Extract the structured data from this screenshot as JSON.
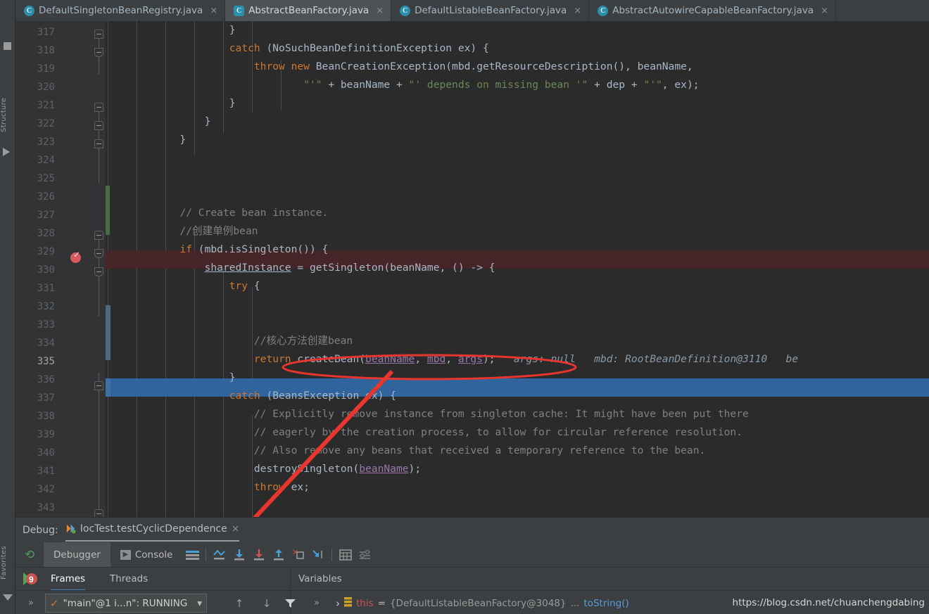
{
  "window": {
    "background": "#2b2b2b",
    "accent": "#4a88c7"
  },
  "left_strip": {
    "labels": [
      "Structure",
      "Favorites"
    ],
    "icons": [
      "tool-window-square-icon",
      "run-arrow-icon",
      "filter-icon"
    ]
  },
  "tabs": [
    {
      "label": "DefaultSingletonBeanRegistry.java",
      "icon": "java-class-icon",
      "active": false,
      "close": "×"
    },
    {
      "label": "AbstractBeanFactory.java",
      "icon": "java-class-icon",
      "active": true,
      "close": "×"
    },
    {
      "label": "DefaultListableBeanFactory.java",
      "icon": "java-class-icon",
      "active": false,
      "close": "×"
    },
    {
      "label": "AbstractAutowireCapableBeanFactory.java",
      "icon": "java-class-icon",
      "active": false,
      "close": "×"
    }
  ],
  "editor": {
    "first_line": 317,
    "current_line": 335,
    "breakpoint_line": 329,
    "line_numbers": [
      317,
      318,
      319,
      320,
      321,
      322,
      323,
      324,
      325,
      326,
      327,
      328,
      329,
      330,
      331,
      332,
      333,
      334,
      335,
      336,
      337,
      338,
      339,
      340,
      341,
      342,
      343
    ],
    "inline_debug_values": [
      "args: null",
      "mbd: RootBeanDefinition@3110",
      "be"
    ],
    "code_lines": [
      {
        "n": 317,
        "text": "                    }"
      },
      {
        "n": 318,
        "text": "                    catch (NoSuchBeanDefinitionException ex) {"
      },
      {
        "n": 319,
        "text": "                        throw new BeanCreationException(mbd.getResourceDescription(), beanName,"
      },
      {
        "n": 320,
        "text": "                                \"'\" + beanName + \"' depends on missing bean '\" + dep + \"'\", ex);"
      },
      {
        "n": 321,
        "text": "                    }"
      },
      {
        "n": 322,
        "text": "                }"
      },
      {
        "n": 323,
        "text": "            }"
      },
      {
        "n": 324,
        "text": ""
      },
      {
        "n": 325,
        "text": ""
      },
      {
        "n": 326,
        "text": ""
      },
      {
        "n": 327,
        "text": "            // Create bean instance."
      },
      {
        "n": 328,
        "text": "            //创建单例bean"
      },
      {
        "n": 329,
        "text": "            if (mbd.isSingleton()) {"
      },
      {
        "n": 330,
        "text": "                sharedInstance = getSingleton(beanName, () -> {"
      },
      {
        "n": 331,
        "text": "                    try {"
      },
      {
        "n": 332,
        "text": ""
      },
      {
        "n": 333,
        "text": ""
      },
      {
        "n": 334,
        "text": "                        //核心方法创建bean"
      },
      {
        "n": 335,
        "text": "                        return createBean(beanName, mbd, args);"
      },
      {
        "n": 336,
        "text": "                    }"
      },
      {
        "n": 337,
        "text": "                    catch (BeansException ex) {"
      },
      {
        "n": 338,
        "text": "                        // Explicitly remove instance from singleton cache: It might have been put there"
      },
      {
        "n": 339,
        "text": "                        // eagerly by the creation process, to allow for circular reference resolution."
      },
      {
        "n": 340,
        "text": "                        // Also remove any beans that received a temporary reference to the bean."
      },
      {
        "n": 341,
        "text": "                        destroySingleton(beanName);"
      },
      {
        "n": 342,
        "text": "                        throw ex;"
      },
      {
        "n": 343,
        "text": ""
      }
    ]
  },
  "annotations": {
    "ellipse_around": "return createBean(beanName, mbd, args);",
    "arrow_from": "step-into-button",
    "color": "#e8352e"
  },
  "debug": {
    "title": "Debug:",
    "run_config": "IocTest.testCyclicDependence",
    "run_config_close": "×",
    "rerun_icon": "rerun-icon",
    "tabs": [
      {
        "label": "Debugger",
        "icon": "debugger-icon",
        "selected": true
      },
      {
        "label": "Console",
        "icon": "console-icon",
        "selected": false
      }
    ],
    "toolbar_icons": [
      "layout-lines-icon",
      "show-execution-point-icon",
      "step-over-icon",
      "step-into-icon",
      "step-out-icon",
      "force-step-into-icon",
      "run-to-cursor-icon",
      "evaluate-expression-icon",
      "settings-icon"
    ],
    "frames_panel": {
      "tabs": [
        {
          "label": "Frames",
          "selected": true
        },
        {
          "label": "Threads",
          "selected": false
        }
      ],
      "thread_selector": "\"main\"@1 i...n\": RUNNING",
      "thread_selector_check": "✓",
      "thread_selector_caret": "▾",
      "overflow": "»",
      "buttons": [
        "up-arrow-icon",
        "down-arrow-icon",
        "filter-icon"
      ]
    },
    "variables_panel": {
      "title": "Variables",
      "overflow": "»",
      "expand_caret": "›",
      "rows": [
        {
          "name": "this",
          "equals": "=",
          "value": "{DefaultListableBeanFactory@3048}",
          "ellipsis": "...",
          "to_string": "toString()"
        }
      ]
    },
    "breakpoint_counter": "9"
  },
  "watermark": "https://blog.csdn.net/chuanchengdabing"
}
